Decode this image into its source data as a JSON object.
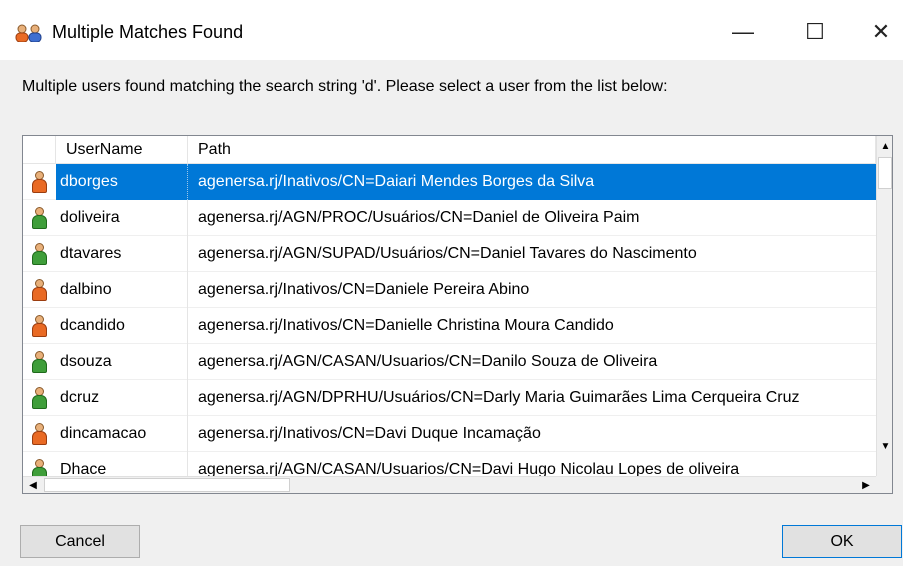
{
  "window": {
    "title": "Multiple Matches Found",
    "minimize": "—",
    "maximize": "☐",
    "close": "✕"
  },
  "message": "Multiple users found matching the search string 'd'.  Please select a user from the list below:",
  "columns": {
    "username": "UserName",
    "path": "Path"
  },
  "rows": [
    {
      "username": "dborges",
      "path": "agenersa.rj/Inativos/CN=Daiari Mendes Borges da Silva",
      "icon": "orange-user-icon",
      "selected": true
    },
    {
      "username": "doliveira",
      "path": "agenersa.rj/AGN/PROC/Usuários/CN=Daniel de Oliveira Paim",
      "icon": "green-user-icon"
    },
    {
      "username": "dtavares",
      "path": "agenersa.rj/AGN/SUPAD/Usuários/CN=Daniel Tavares do Nascimento",
      "icon": "green-user-icon"
    },
    {
      "username": "dalbino",
      "path": "agenersa.rj/Inativos/CN=Daniele Pereira Abino",
      "icon": "orange-user-icon"
    },
    {
      "username": "dcandido",
      "path": "agenersa.rj/Inativos/CN=Danielle Christina Moura Candido",
      "icon": "orange-user-icon"
    },
    {
      "username": "dsouza",
      "path": "agenersa.rj/AGN/CASAN/Usuarios/CN=Danilo Souza de Oliveira",
      "icon": "green-user-icon"
    },
    {
      "username": "dcruz",
      "path": "agenersa.rj/AGN/DPRHU/Usuários/CN=Darly Maria Guimarães Lima Cerqueira Cruz",
      "icon": "green-user-icon"
    },
    {
      "username": "dincamacao",
      "path": "agenersa.rj/Inativos/CN=Davi Duque Incamação",
      "icon": "orange-user-icon"
    },
    {
      "username": "Dhace",
      "path": "agenersa.rj/AGN/CASAN/Usuarios/CN=Davi Hugo Nicolau Lopes de oliveira",
      "icon": "green-user-icon"
    }
  ],
  "buttons": {
    "cancel": "Cancel",
    "ok": "OK"
  },
  "colors": {
    "selection": "#0078d7",
    "orange_user": "#e96a24",
    "green_user": "#3f9e3a"
  }
}
